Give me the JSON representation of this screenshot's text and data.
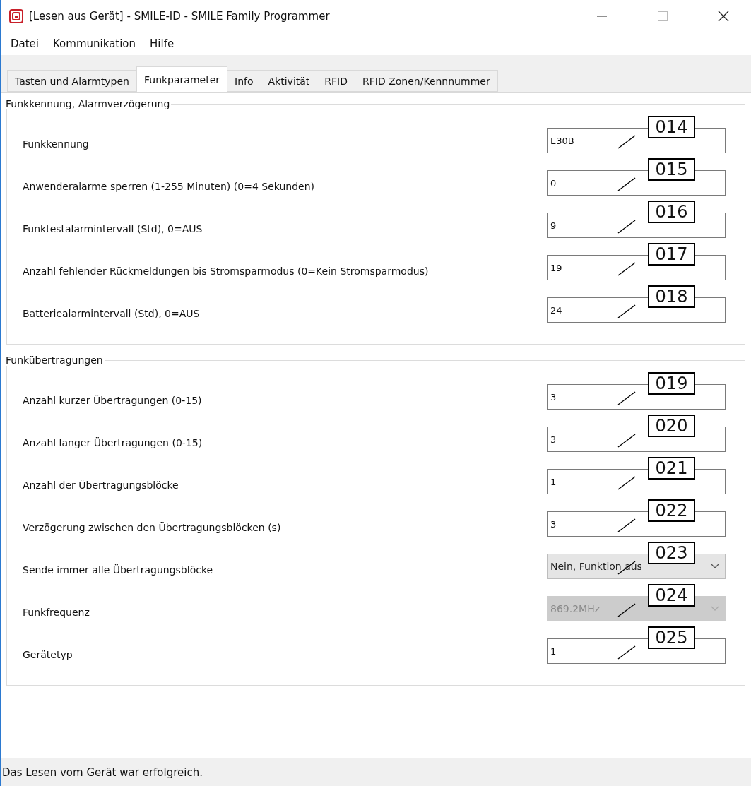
{
  "window": {
    "title": "[Lesen aus Gerät] - SMILE-ID - SMILE Family Programmer"
  },
  "menu": [
    "Datei",
    "Kommunikation",
    "Hilfe"
  ],
  "tabs": [
    {
      "label": "Tasten und Alarmtypen",
      "selected": false
    },
    {
      "label": "Funkparameter",
      "selected": true
    },
    {
      "label": "Info",
      "selected": false
    },
    {
      "label": "Aktivität",
      "selected": false
    },
    {
      "label": "RFID",
      "selected": false
    },
    {
      "label": "RFID Zonen/Kennnummer",
      "selected": false
    }
  ],
  "groups": [
    {
      "title": "Funkkennung, Alarmverzögerung",
      "rows": [
        {
          "label": "Funkkennung",
          "kind": "text",
          "value": "E30B",
          "callout": "014"
        },
        {
          "label": "Anwenderalarme sperren (1-255 Minuten) (0=4 Sekunden)",
          "kind": "text",
          "value": "0",
          "callout": "015"
        },
        {
          "label": "Funktestalarmintervall (Std), 0=AUS",
          "kind": "text",
          "value": "9",
          "callout": "016"
        },
        {
          "label": "Anzahl fehlender Rückmeldungen bis Stromsparmodus (0=Kein Stromsparmodus)",
          "kind": "text",
          "value": "19",
          "callout": "017"
        },
        {
          "label": "Batteriealarmintervall (Std), 0=AUS",
          "kind": "text",
          "value": "24",
          "callout": "018"
        }
      ]
    },
    {
      "title": "Funkübertragungen",
      "rows": [
        {
          "label": "Anzahl kurzer Übertragungen (0-15)",
          "kind": "text",
          "value": "3",
          "callout": "019"
        },
        {
          "label": "Anzahl langer Übertragungen (0-15)",
          "kind": "text",
          "value": "3",
          "callout": "020"
        },
        {
          "label": "Anzahl der Übertragungsblöcke",
          "kind": "text",
          "value": "1",
          "callout": "021"
        },
        {
          "label": "Verzögerung zwischen den Übertragungsblöcken (s)",
          "kind": "text",
          "value": "3",
          "callout": "022"
        },
        {
          "label": "Sende immer alle Übertragungsblöcke",
          "kind": "select",
          "value": "Nein, Funktion aus",
          "disabled": false,
          "callout": "023"
        },
        {
          "label": "Funkfrequenz",
          "kind": "select",
          "value": "869.2MHz",
          "disabled": true,
          "callout": "024"
        },
        {
          "label": "Gerätetyp",
          "kind": "text",
          "value": "1",
          "callout": "025"
        }
      ]
    }
  ],
  "status_bar": "Das Lesen vom Gerät war erfolgreich."
}
